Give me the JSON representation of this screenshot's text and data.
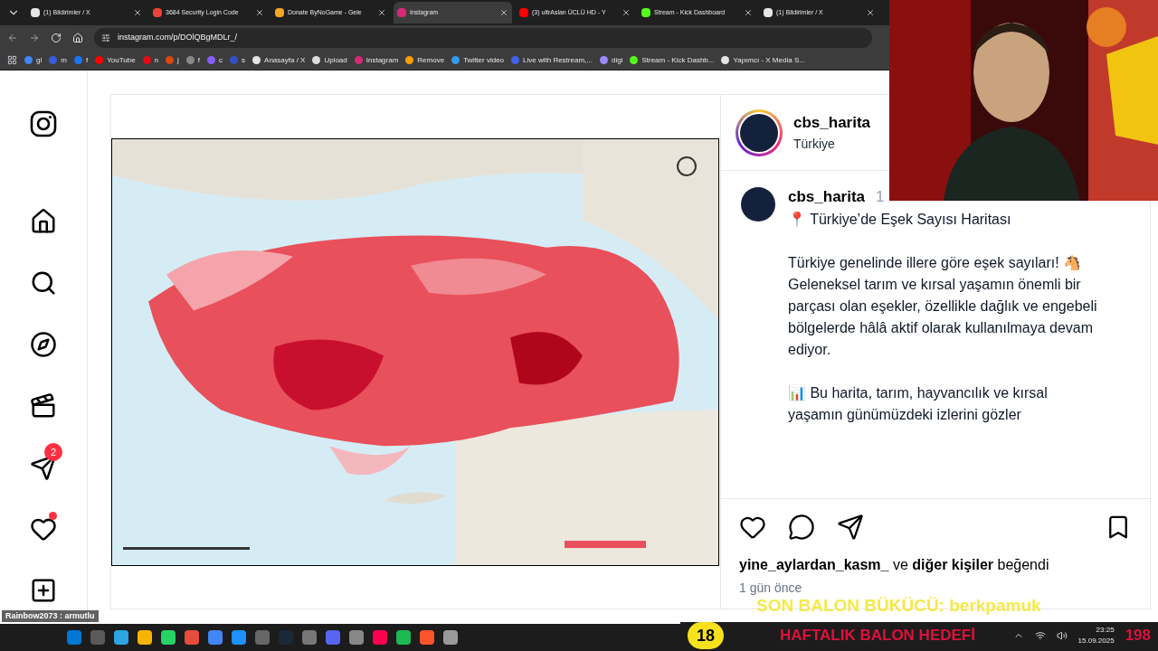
{
  "tabs": [
    {
      "label": "(1) Bildirimler / X",
      "color": "#e5e5e5",
      "selected": false
    },
    {
      "label": "3684 Security Login Code",
      "color": "#ea4335",
      "selected": false
    },
    {
      "label": "Donate ByNoGame - Gele",
      "color": "#f5a623",
      "selected": false
    },
    {
      "label": "Instagram",
      "color": "#d62976",
      "selected": true
    },
    {
      "label": "(3) ultrAslan ÜCLÜ HD - Y",
      "color": "#ff0000",
      "selected": false
    },
    {
      "label": "Stream - Kick Dashboard",
      "color": "#53fc18",
      "selected": false
    },
    {
      "label": "(1) Bildirimler / X",
      "color": "#e5e5e5",
      "selected": false
    }
  ],
  "address": "instagram.com/p/DOlQBgMDLr_/",
  "bookmarks": [
    {
      "label": "gl",
      "color": "#4285f4"
    },
    {
      "label": "m",
      "color": "#3b5bdb"
    },
    {
      "label": "f",
      "color": "#1877f2"
    },
    {
      "label": "YouTube",
      "color": "#ff0000"
    },
    {
      "label": "n",
      "color": "#e50914"
    },
    {
      "label": "j",
      "color": "#d9480f"
    },
    {
      "label": "f",
      "color": "#888888"
    },
    {
      "label": "c",
      "color": "#845ef7"
    },
    {
      "label": "s",
      "color": "#364fc7"
    },
    {
      "label": "Anasayfa / X",
      "color": "#e5e5e5"
    },
    {
      "label": "Upload",
      "color": "#dddddd"
    },
    {
      "label": "Instagram",
      "color": "#d62976"
    },
    {
      "label": "Remove",
      "color": "#f59f00"
    },
    {
      "label": "Twitter video",
      "color": "#339af0"
    },
    {
      "label": "Live with Restream,...",
      "color": "#4263eb"
    },
    {
      "label": "digi",
      "color": "#9c88ff"
    },
    {
      "label": "Stream - Kick Dashb...",
      "color": "#53fc18"
    },
    {
      "label": "Yapımcı - X Media S...",
      "color": "#e5e5e5"
    }
  ],
  "sidebar": {
    "notifications_badge": "2",
    "activity_dot": true
  },
  "post": {
    "header": {
      "user": "cbs_harita",
      "location": "Türkiye"
    },
    "caption": {
      "user": "cbs_harita",
      "time": "1",
      "blocks": [
        [
          "📍 Türkiye’de Eşek Sayısı Haritası"
        ],
        [
          "Türkiye genelinde illere göre eşek sayıları! 🐴",
          "Geleneksel tarım ve kırsal yaşamın önemli bir parçası olan eşekler, özellikle dağlık ve engebeli bölgelerde hâlâ aktif olarak kullanılmaya devam ediyor."
        ],
        [
          "📊 Bu harita, tarım, hayvancılık ve kırsal yaşamın günümüzdeki izlerini gözler"
        ]
      ]
    },
    "likes": "**yine_aylardan_kasm_** ve **diğer kişiler** beğendi",
    "date": "1 gün önce"
  },
  "overlay": {
    "chat": [
      "Rainbow2073 : armutlu"
    ],
    "last_bender": "SON BALON BÜKÜCÜ: berkpamuk",
    "weekly_goal_count": "18",
    "weekly_goal": "HAFTALIK BALON HEDEFİ",
    "goal_total": "198"
  },
  "clock": {
    "time": "23:25",
    "date": "15.09.2025"
  }
}
